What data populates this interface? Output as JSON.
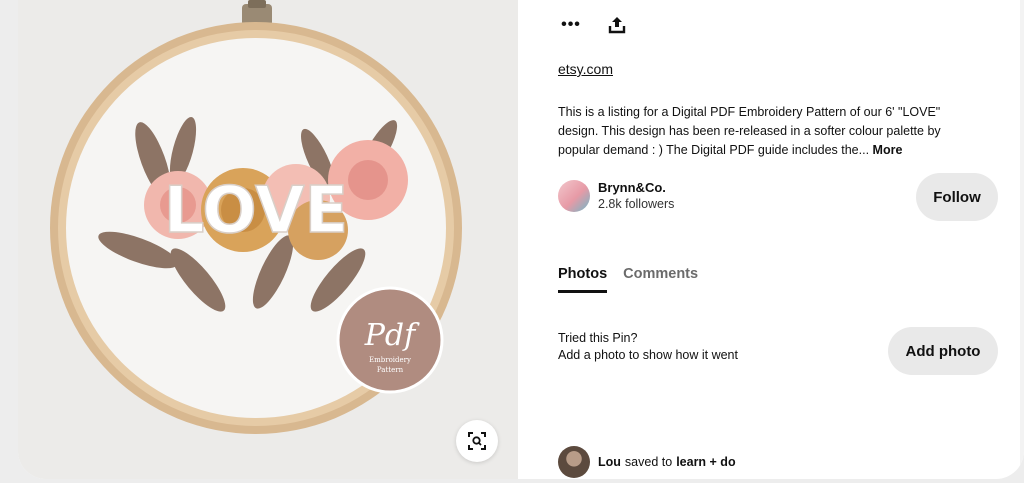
{
  "actions": {
    "more_glyph": "•••",
    "share_icon": "share-icon"
  },
  "image": {
    "hoop_text": "LOVE",
    "badge_script": "Pdf",
    "badge_line1": "Embroidery",
    "badge_line2": "Pattern",
    "lens_icon": "visual-search-icon"
  },
  "pin": {
    "source": "etsy.com",
    "description": "This is a listing for a Digital PDF Embroidery Pattern of our 6' \"LOVE\" design. This design has been re-released in a softer colour palette by popular demand : ) The Digital PDF guide includes the...",
    "more_label": "More"
  },
  "creator": {
    "name": "Brynn&Co.",
    "followers": "2.8k followers",
    "follow_label": "Follow"
  },
  "tabs": {
    "photos": "Photos",
    "comments": "Comments"
  },
  "tried": {
    "line1": "Tried this Pin?",
    "line2": "Add a photo to show how it went",
    "button": "Add photo"
  },
  "saved": {
    "user": "Lou",
    "verb": "saved to",
    "board": "learn + do"
  },
  "colors": {
    "pill_bg": "#e9e9e9",
    "badge_bg": "#b08c80",
    "page_bg": "#ededed"
  }
}
